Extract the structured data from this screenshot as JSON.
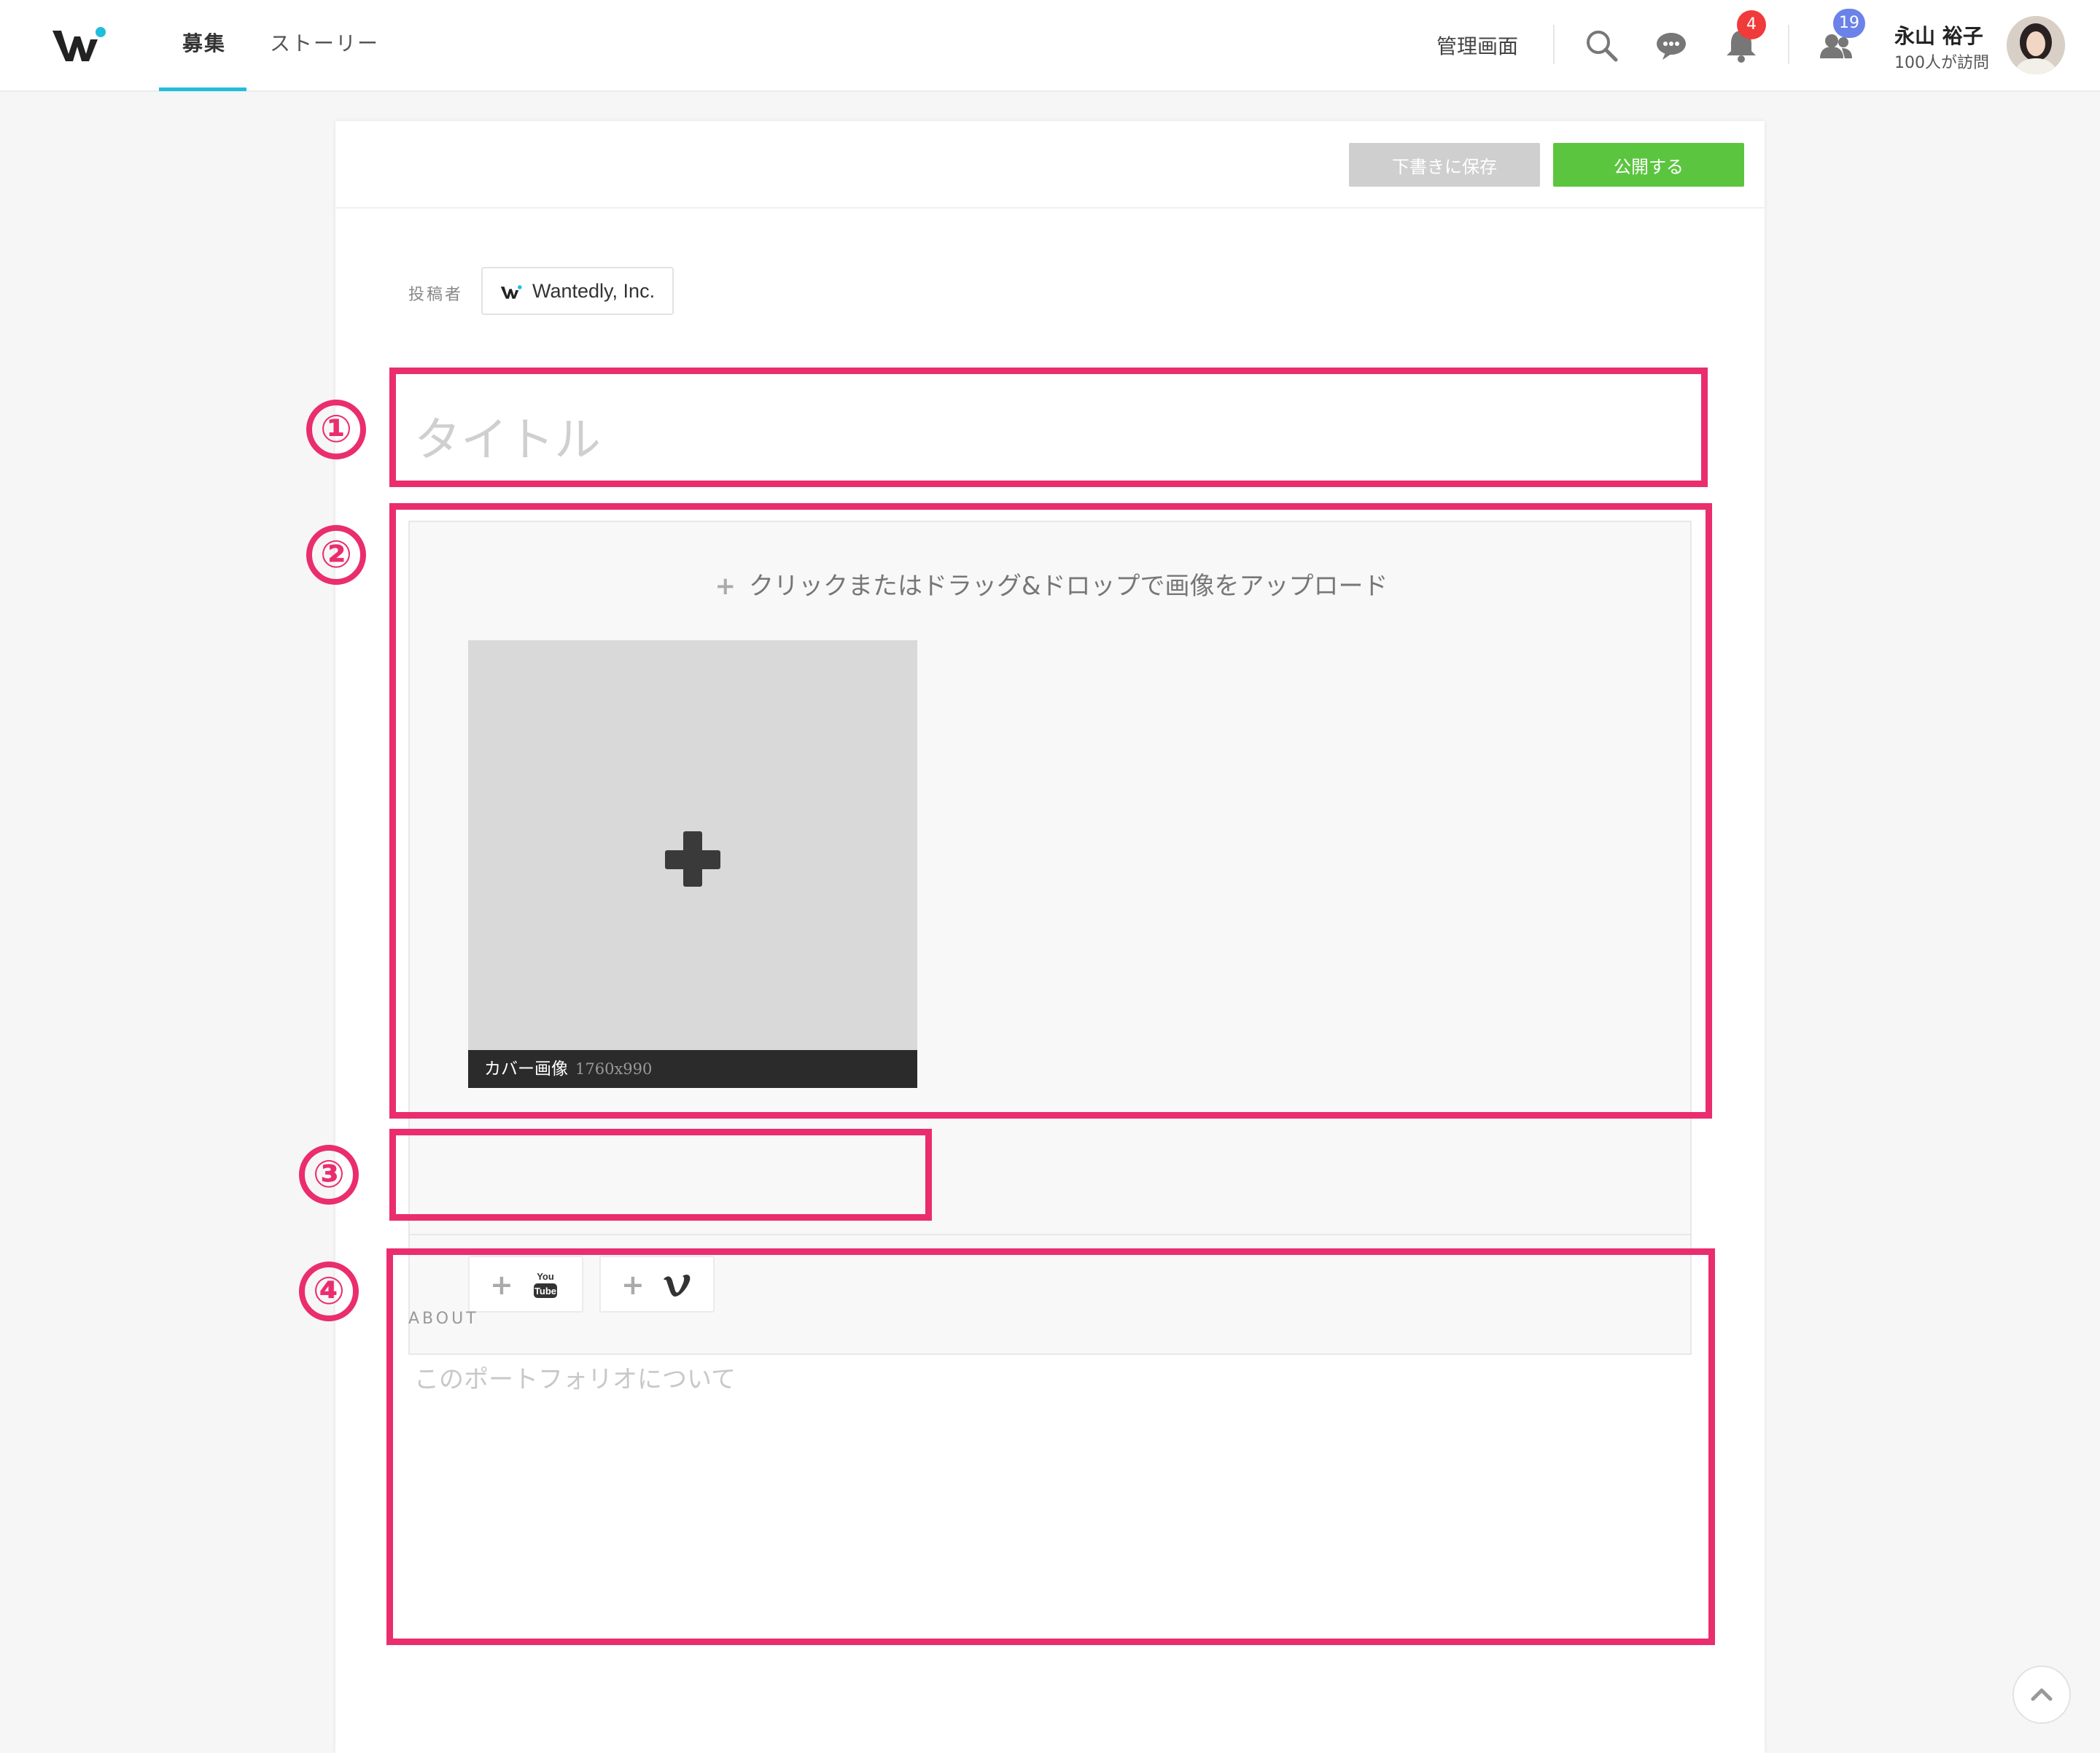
{
  "nav": {
    "tabs": [
      "募集",
      "ストーリー"
    ],
    "admin_label": "管理画面",
    "notification_count": "4",
    "visitor_count": "19",
    "user_name": "永山 裕子",
    "user_sub": "100人が訪問",
    "accent_color": "#21bddb"
  },
  "editor": {
    "save_draft_label": "下書きに保存",
    "publish_label": "公開する",
    "poster_label": "投稿者",
    "poster_name": "Wantedly, Inc.",
    "title_placeholder": "タイトル",
    "upload_text": "クリックまたはドラッグ&ドロップで画像をアップロード",
    "cover_label": "カバー画像",
    "cover_dims": "1760x990",
    "about_label": "ABOUT",
    "about_placeholder": "このポートフォリオについて",
    "publish_color": "#5cc540"
  },
  "annotations": [
    "①",
    "②",
    "③",
    "④"
  ],
  "annotation_color": "#ea2d6e"
}
